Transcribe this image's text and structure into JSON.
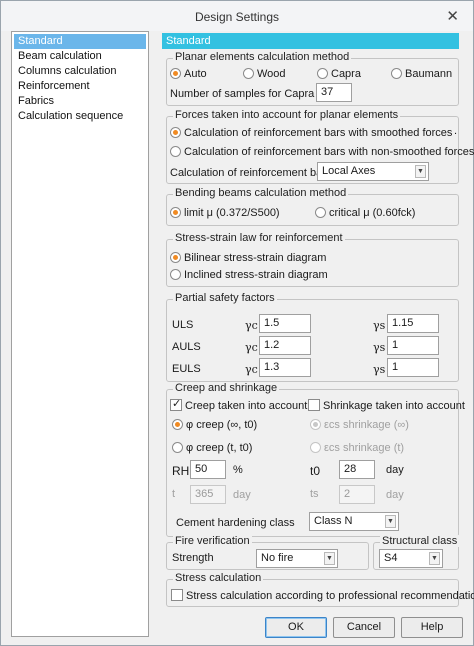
{
  "window": {
    "title": "Design Settings"
  },
  "sidebar": {
    "items": [
      {
        "label": "Standard"
      },
      {
        "label": "Beam calculation"
      },
      {
        "label": "Columns calculation"
      },
      {
        "label": "Reinforcement"
      },
      {
        "label": "Fabrics"
      },
      {
        "label": "Calculation sequence"
      }
    ],
    "selected": "Standard"
  },
  "panel": {
    "title": "Standard"
  },
  "planar": {
    "legend": "Planar elements calculation method",
    "options": [
      "Auto",
      "Wood",
      "Capra",
      "Baumann"
    ],
    "selected": "Auto",
    "samples_label": "Number of samples for Capra",
    "samples_value": "37"
  },
  "forces": {
    "legend": "Forces taken into account for planar elements",
    "option_smoothed": "Calculation of reinforcement bars with smoothed forces",
    "option_nonsmoothed": "Calculation of reinforcement bars with non-smoothed forces",
    "selected": "smoothed",
    "calc_label": "Calculation of reinforcement bars",
    "calc_value": "Local Axes",
    "dot": "."
  },
  "bending": {
    "legend": "Bending beams calculation method",
    "option_limit": "limit μ (0.372/S500)",
    "option_critical": "critical μ (0.60fck)",
    "selected": "limit"
  },
  "stress_strain": {
    "legend": "Stress-strain law for reinforcement",
    "option_bilinear": "Bilinear stress-strain diagram",
    "option_inclined": "Inclined stress-strain diagram",
    "selected": "bilinear"
  },
  "safety": {
    "legend": "Partial safety factors",
    "gamma_c": "γc",
    "gamma_s": "γs",
    "rows": [
      {
        "name": "ULS",
        "gc": "1.5",
        "gs": "1.15"
      },
      {
        "name": "AULS",
        "gc": "1.2",
        "gs": "1"
      },
      {
        "name": "EULS",
        "gc": "1.3",
        "gs": "1"
      }
    ]
  },
  "creep": {
    "legend": "Creep and shrinkage",
    "creep_check": "Creep taken into account",
    "creep_checked": true,
    "shrinkage_check": "Shrinkage taken into account",
    "shrinkage_checked": false,
    "phi_creep_inf": "φ creep (∞, t0)",
    "phi_creep_t": "φ creep (t, t0)",
    "ecs_inf": "εcs shrinkage (∞)",
    "ecs_t": "εcs shrinkage (t)",
    "rh_label": "RH",
    "rh_value": "50",
    "rh_unit": "%",
    "t0_label": "t0",
    "t0_value": "28",
    "t0_unit": "day",
    "t_label": "t",
    "t_value": "365",
    "t_unit": "day",
    "ts_label": "ts",
    "ts_value": "2",
    "ts_unit": "day",
    "cement_label": "Cement hardening class",
    "cement_value": "Class N"
  },
  "fire": {
    "legend": "Fire verification",
    "strength_label": "Strength",
    "strength_value": "No fire"
  },
  "structural": {
    "legend": "Structural class",
    "value": "S4"
  },
  "stress_calc": {
    "legend": "Stress calculation",
    "check_label": "Stress calculation according to professional recommendations",
    "checked": false
  },
  "buttons": {
    "ok": "OK",
    "cancel": "Cancel",
    "help": "Help"
  }
}
